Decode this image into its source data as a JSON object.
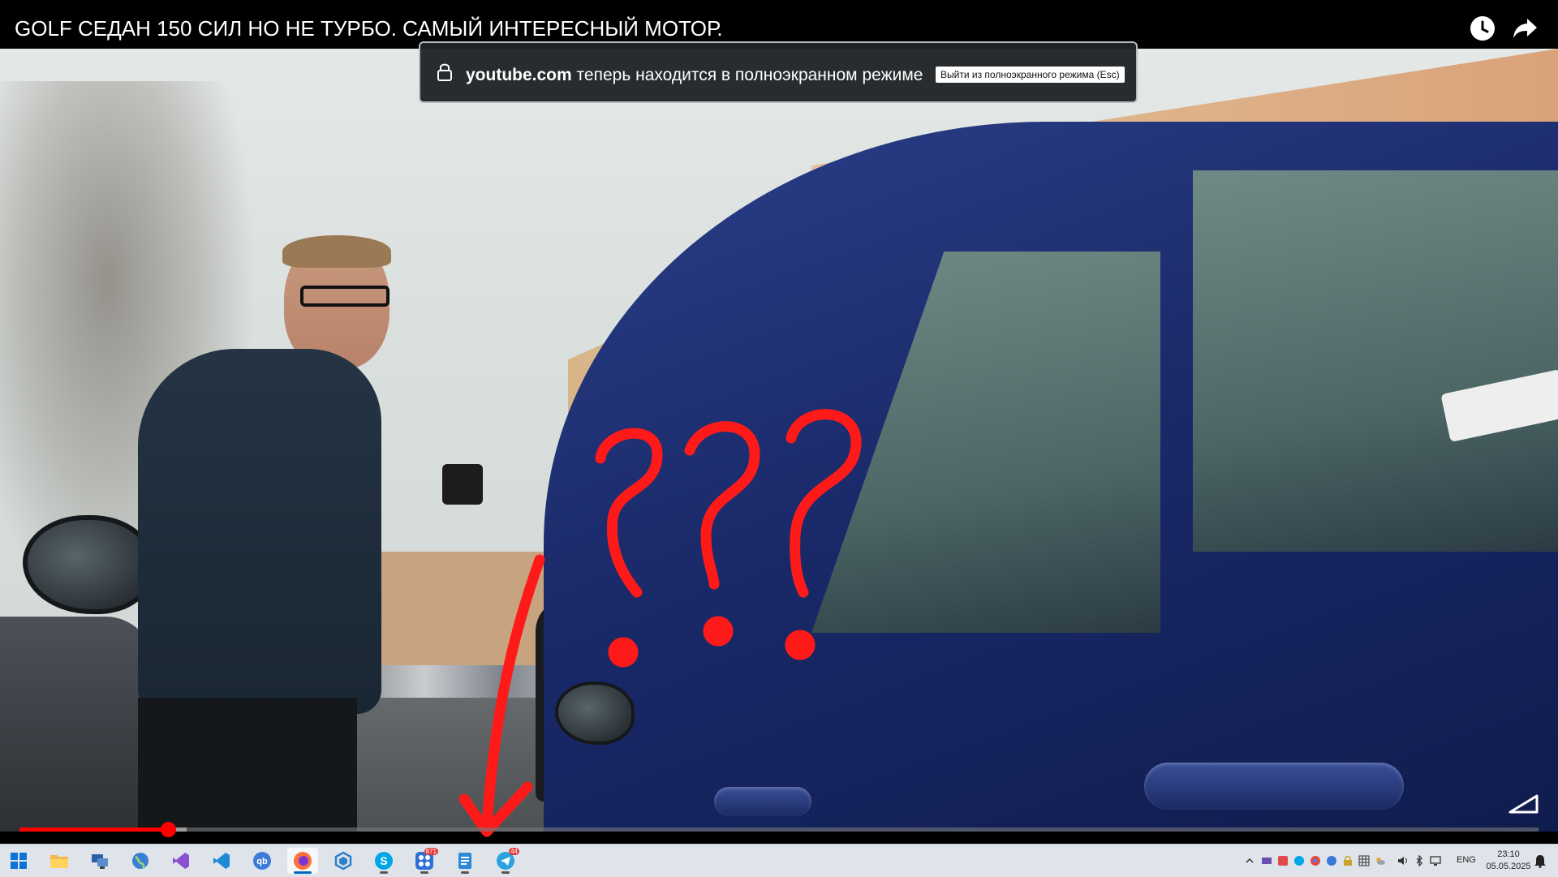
{
  "video": {
    "title": "GOLF СЕДАН 150 СИЛ НО НЕ ТУРБО. САМЫЙ ИНТЕРЕСНЫЙ МОТОР.",
    "progress_fraction": 0.098,
    "buffered_fraction": 0.11,
    "overlay_annotation": "???"
  },
  "toolbar_icons": [
    "watch-later-icon",
    "share-icon",
    "quality-icon"
  ],
  "fullscreen_toast": {
    "domain": "youtube.com",
    "message": "теперь находится в полноэкранном режиме",
    "exit_button": "Выйти из полноэкранного режима (Esc)"
  },
  "taskbar": {
    "apps": [
      {
        "name": "start",
        "icon": "windows-icon",
        "active": false,
        "open": false
      },
      {
        "name": "file-explorer",
        "icon": "folder-icon",
        "active": false,
        "open": false
      },
      {
        "name": "remote-desktop",
        "icon": "computer-icon",
        "active": false,
        "open": false
      },
      {
        "name": "globe-app",
        "icon": "globe-icon",
        "active": false,
        "open": false
      },
      {
        "name": "visual-studio",
        "icon": "visual-studio-icon",
        "active": false,
        "open": false
      },
      {
        "name": "vscode",
        "icon": "vscode-icon",
        "active": false,
        "open": false
      },
      {
        "name": "qbittorrent",
        "icon": "qbittorrent-icon",
        "active": false,
        "open": false
      },
      {
        "name": "firefox",
        "icon": "firefox-icon",
        "active": true,
        "open": true
      },
      {
        "name": "cube-app",
        "icon": "cube-icon",
        "active": false,
        "open": false
      },
      {
        "name": "skype",
        "icon": "skype-icon",
        "active": false,
        "open": true
      },
      {
        "name": "app-grid",
        "icon": "app-grid-icon",
        "active": false,
        "open": true,
        "badge": "871"
      },
      {
        "name": "notepad",
        "icon": "notepad-icon",
        "active": false,
        "open": true
      },
      {
        "name": "telegram",
        "icon": "telegram-icon",
        "active": false,
        "open": true,
        "badge": "44"
      }
    ],
    "tray": {
      "language": "ENG",
      "time": "23:10",
      "date": "05.05.2025",
      "icons": [
        "chevron-up-icon",
        "tray-app-icon",
        "antivirus-icon",
        "skype-tray-icon",
        "chrome-tray-icon",
        "cloud-icon",
        "lock-icon",
        "grid-icon",
        "weather-icon",
        "volume-icon",
        "bluetooth-icon",
        "network-icon",
        "notification-bell-icon"
      ]
    }
  },
  "colors": {
    "progress": "#ff0000",
    "taskbar_bg": "#dfe4ea",
    "toast_bg": "#202428",
    "annotation": "#ff1a1a"
  }
}
